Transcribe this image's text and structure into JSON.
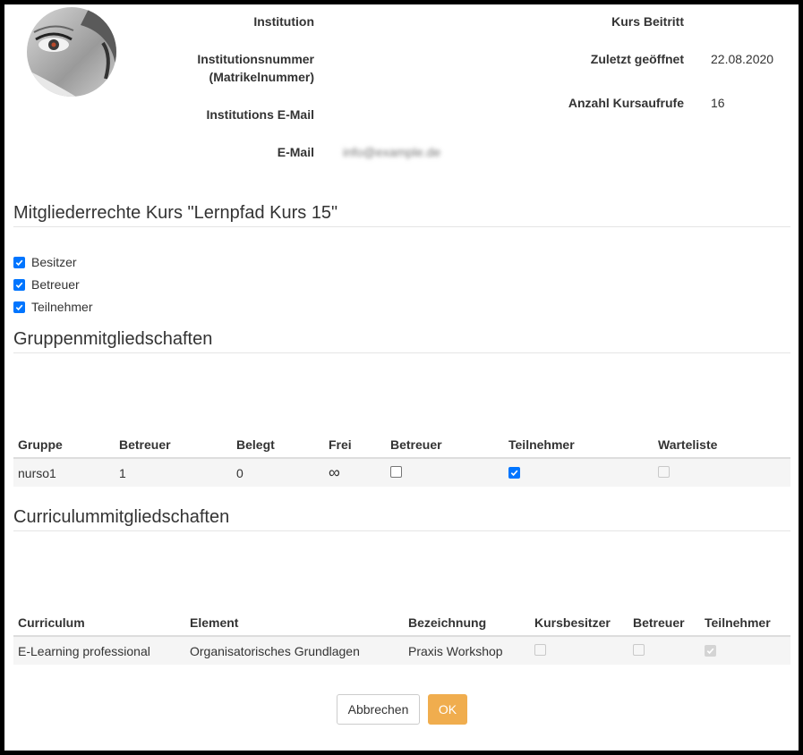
{
  "profile": {
    "institution_label": "Institution",
    "institution_number_label": "Institutionsnummer (Matrikelnummer)",
    "institution_email_label": "Institutions E-Mail",
    "email_label": "E-Mail",
    "email_value": "info@example.de",
    "course_join_label": "Kurs Beitritt",
    "last_opened_label": "Zuletzt geöffnet",
    "last_opened_value": "22.08.2020",
    "course_views_label": "Anzahl Kursaufrufe",
    "course_views_value": "16"
  },
  "rights": {
    "heading": "Mitgliederrechte Kurs \"Lernpfad Kurs 15\"",
    "options": [
      {
        "label": "Besitzer",
        "checked": true
      },
      {
        "label": "Betreuer",
        "checked": true
      },
      {
        "label": "Teilnehmer",
        "checked": true
      }
    ]
  },
  "groups": {
    "heading": "Gruppenmitgliedschaften",
    "columns": [
      "Gruppe",
      "Betreuer",
      "Belegt",
      "Frei",
      "Betreuer",
      "Teilnehmer",
      "Warteliste"
    ],
    "rows": [
      {
        "gruppe": "nurso1",
        "betreuer": "1",
        "belegt": "0",
        "frei": "∞",
        "cb_betreuer": false,
        "cb_teilnehmer": true,
        "cb_warteliste": false
      }
    ]
  },
  "curricula": {
    "heading": "Curriculummitgliedschaften",
    "columns": [
      "Curriculum",
      "Element",
      "Bezeichnung",
      "Kursbesitzer",
      "Betreuer",
      "Teilnehmer"
    ],
    "rows": [
      {
        "curriculum": "E-Learning professional",
        "element": "Organisatorisches Grundlagen",
        "bezeichnung": "Praxis Workshop",
        "kursbesitzer": false,
        "betreuer": false,
        "teilnehmer": true
      }
    ]
  },
  "actions": {
    "cancel_label": "Abbrechen",
    "ok_label": "OK"
  },
  "colors": {
    "accent": "#f0ad4e",
    "checkbox": "#0075ff"
  }
}
